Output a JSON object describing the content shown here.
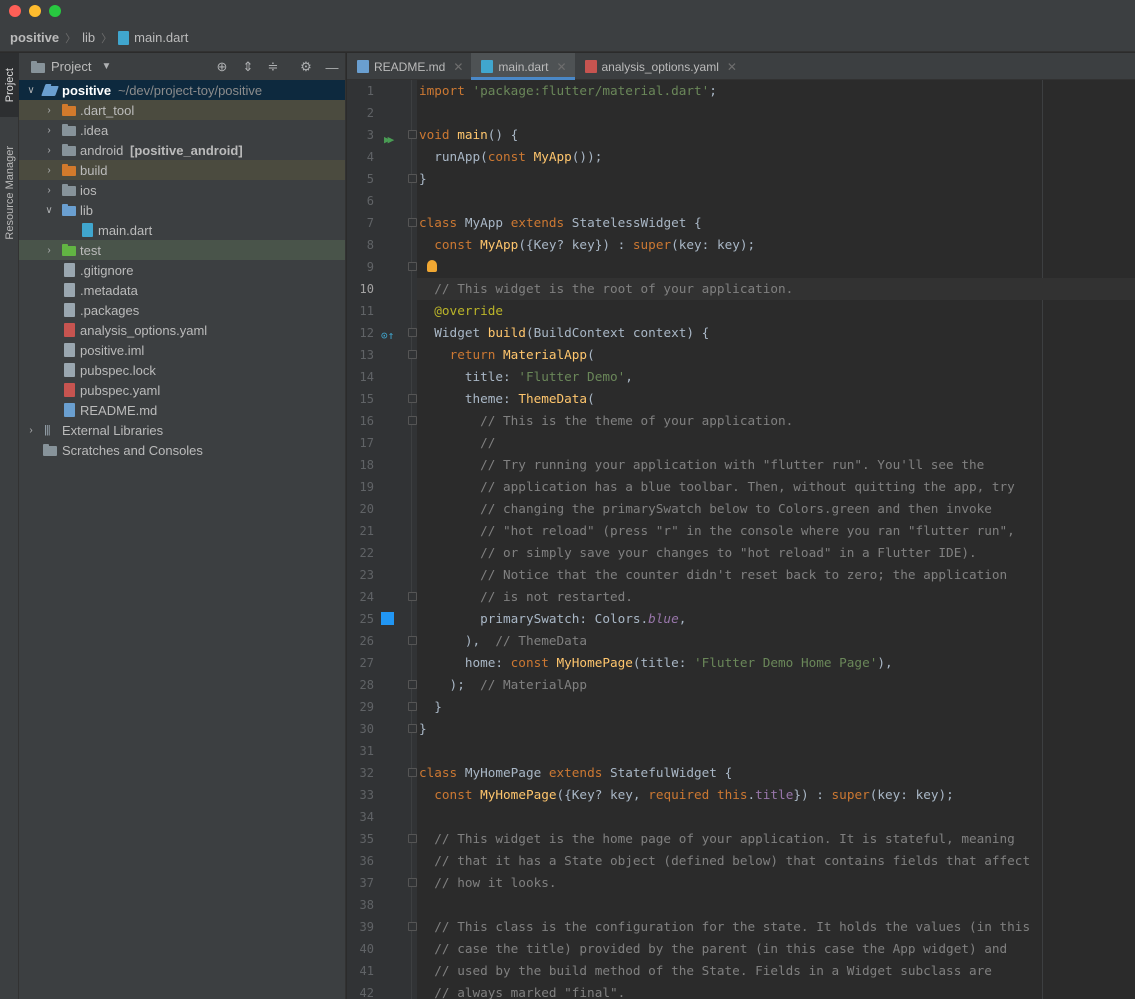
{
  "breadcrumb": {
    "project": "positive",
    "folder": "lib",
    "file": "main.dart"
  },
  "sidebar_strip": {
    "project_tab": "Project",
    "resource_tab": "Resource Manager"
  },
  "panel": {
    "title": "Project",
    "root": {
      "name": "positive",
      "path": "~/dev/project-toy/positive"
    },
    "items": [
      {
        "name": ".dart_tool"
      },
      {
        "name": ".idea"
      },
      {
        "name": "android",
        "suffix": "[positive_android]"
      },
      {
        "name": "build"
      },
      {
        "name": "ios"
      },
      {
        "name": "lib"
      },
      {
        "name": "main.dart"
      },
      {
        "name": "test"
      },
      {
        "name": ".gitignore"
      },
      {
        "name": ".metadata"
      },
      {
        "name": ".packages"
      },
      {
        "name": "analysis_options.yaml"
      },
      {
        "name": "positive.iml"
      },
      {
        "name": "pubspec.lock"
      },
      {
        "name": "pubspec.yaml"
      },
      {
        "name": "README.md"
      },
      {
        "name": "External Libraries"
      },
      {
        "name": "Scratches and Consoles"
      }
    ]
  },
  "tabs": [
    {
      "label": "README.md"
    },
    {
      "label": "main.dart"
    },
    {
      "label": "analysis_options.yaml"
    }
  ],
  "editor": {
    "current_line": 10,
    "lines": [
      "import 'package:flutter/material.dart';",
      "",
      "void main() {",
      "  runApp(const MyApp());",
      "}",
      "",
      "class MyApp extends StatelessWidget {",
      "  const MyApp({Key? key}) : super(key: key);",
      "",
      "  // This widget is the root of your application.",
      "  @override",
      "  Widget build(BuildContext context) {",
      "    return MaterialApp(",
      "      title: 'Flutter Demo',",
      "      theme: ThemeData(",
      "        // This is the theme of your application.",
      "        //",
      "        // Try running your application with \"flutter run\". You'll see the",
      "        // application has a blue toolbar. Then, without quitting the app, try",
      "        // changing the primarySwatch below to Colors.green and then invoke",
      "        // \"hot reload\" (press \"r\" in the console where you ran \"flutter run\",",
      "        // or simply save your changes to \"hot reload\" in a Flutter IDE).",
      "        // Notice that the counter didn't reset back to zero; the application",
      "        // is not restarted.",
      "        primarySwatch: Colors.blue,",
      "      ),  // ThemeData",
      "      home: const MyHomePage(title: 'Flutter Demo Home Page'),",
      "    );  // MaterialApp",
      "  }",
      "}",
      "",
      "class MyHomePage extends StatefulWidget {",
      "  const MyHomePage({Key? key, required this.title}) : super(key: key);",
      "",
      "  // This widget is the home page of your application. It is stateful, meaning",
      "  // that it has a State object (defined below) that contains fields that affect",
      "  // how it looks.",
      "",
      "  // This class is the configuration for the state. It holds the values (in this",
      "  // case the title) provided by the parent (in this case the App widget) and",
      "  // used by the build method of the State. Fields in a Widget subclass are",
      "  // always marked \"final\"."
    ]
  },
  "colors": {
    "accent": "#4a88c7",
    "selection": "#0d293e",
    "swatch": "#2196f3"
  }
}
